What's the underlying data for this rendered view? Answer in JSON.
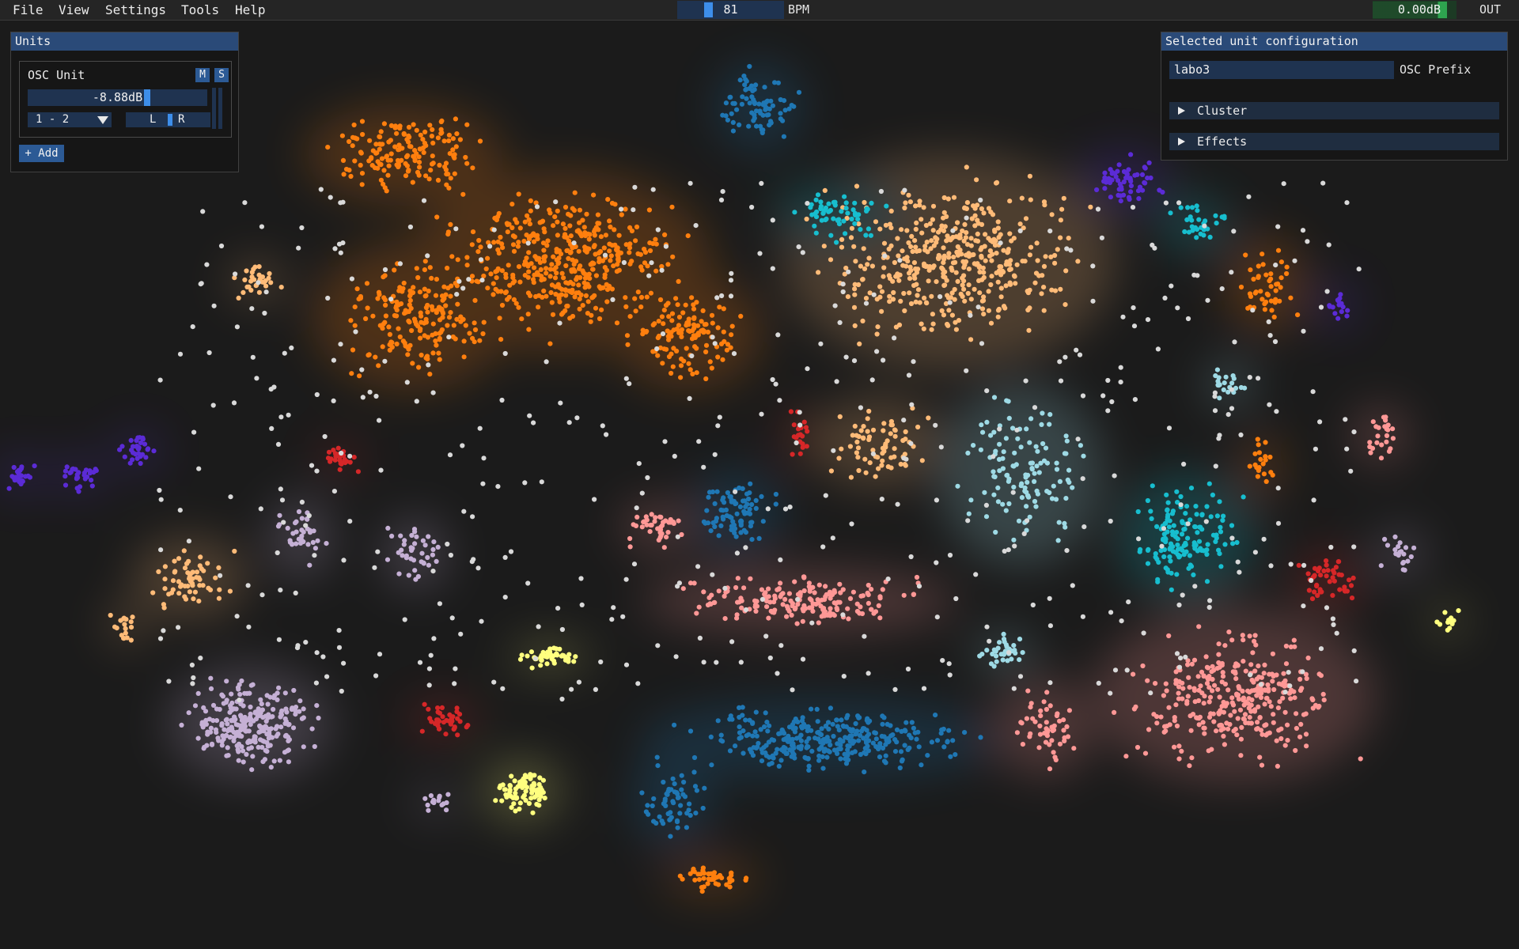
{
  "menu": {
    "items": [
      "File",
      "View",
      "Settings",
      "Tools",
      "Help"
    ],
    "bpm_value": "81",
    "bpm_label": "BPM",
    "master_level": "0.00dB",
    "master_meter_fill": 0.92,
    "out_label": "OUT"
  },
  "units_window": {
    "title": "Units",
    "unit": {
      "name": "OSC Unit",
      "mute_label": "M",
      "solo_label": "S",
      "gain": "-8.88dB",
      "channels": "1 - 2",
      "pan_left_label": "L",
      "pan_right_label": "R",
      "pan_position": 0.5
    },
    "add_label": "+ Add"
  },
  "config_window": {
    "title": "Selected unit configuration",
    "osc_prefix_value": "labo3",
    "osc_prefix_label": "OSC Prefix",
    "sections": [
      "Cluster",
      "Effects"
    ]
  },
  "cluster_colors": {
    "orange": "#ff7f0e",
    "light_orange": "#ffbb78",
    "blue": "#1f77b4",
    "cyan": "#17becf",
    "light_blue": "#9edae5",
    "purple": "#5b2bd6",
    "lavender": "#c5b0d5",
    "pink": "#ff9896",
    "red": "#d62728",
    "yellow": "#ffff7f",
    "white": "#d9d9d9"
  }
}
